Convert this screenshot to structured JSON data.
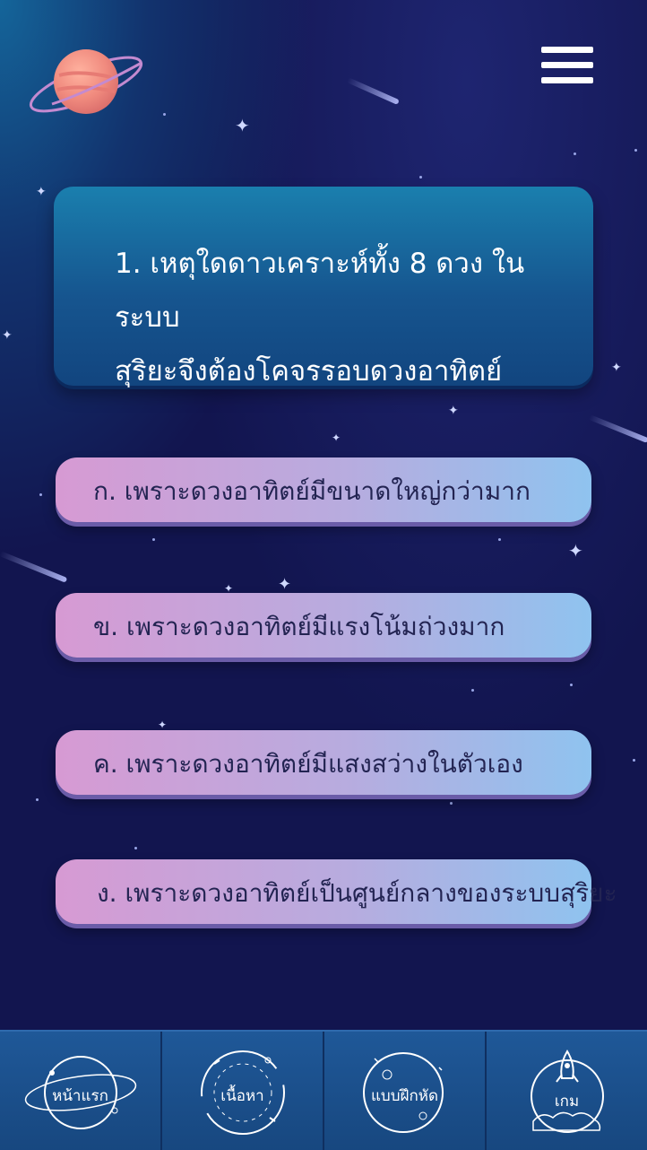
{
  "question": {
    "line1": "1.  เหตุใดดาวเคราะห์ทั้ง 8 ดวง ในระบบ",
    "line2": "สุริยะจึงต้องโคจรรอบดวงอาทิตย์"
  },
  "answers": [
    "ก.  เพราะดวงอาทิตย์มีขนาดใหญ่กว่ามาก",
    "ข.  เพราะดวงอาทิตย์มีแรงโน้มถ่วงมาก",
    "ค.  เพราะดวงอาทิตย์มีแสงสว่างในตัวเอง",
    "ง.  เพราะดวงอาทิตย์เป็นศูนย์กลางของระบบสุริยะ"
  ],
  "nav": [
    "หน้าแรก",
    "เนื้อหา",
    "แบบฝึกหัด",
    "เกม"
  ],
  "icons": {
    "menu": "hamburger-menu-icon",
    "planet": "saturn-planet-icon",
    "home": "orbit-icon",
    "content": "orbit-arrows-icon",
    "exercise": "moon-crater-icon",
    "game": "rocket-icon"
  },
  "colors": {
    "background": "#12154f",
    "question_card": "#16558f",
    "answer_pink": "#d79ad3",
    "answer_blue": "#8fc3ef",
    "nav_bar": "#1c5190",
    "planet": "#f08a7e"
  }
}
